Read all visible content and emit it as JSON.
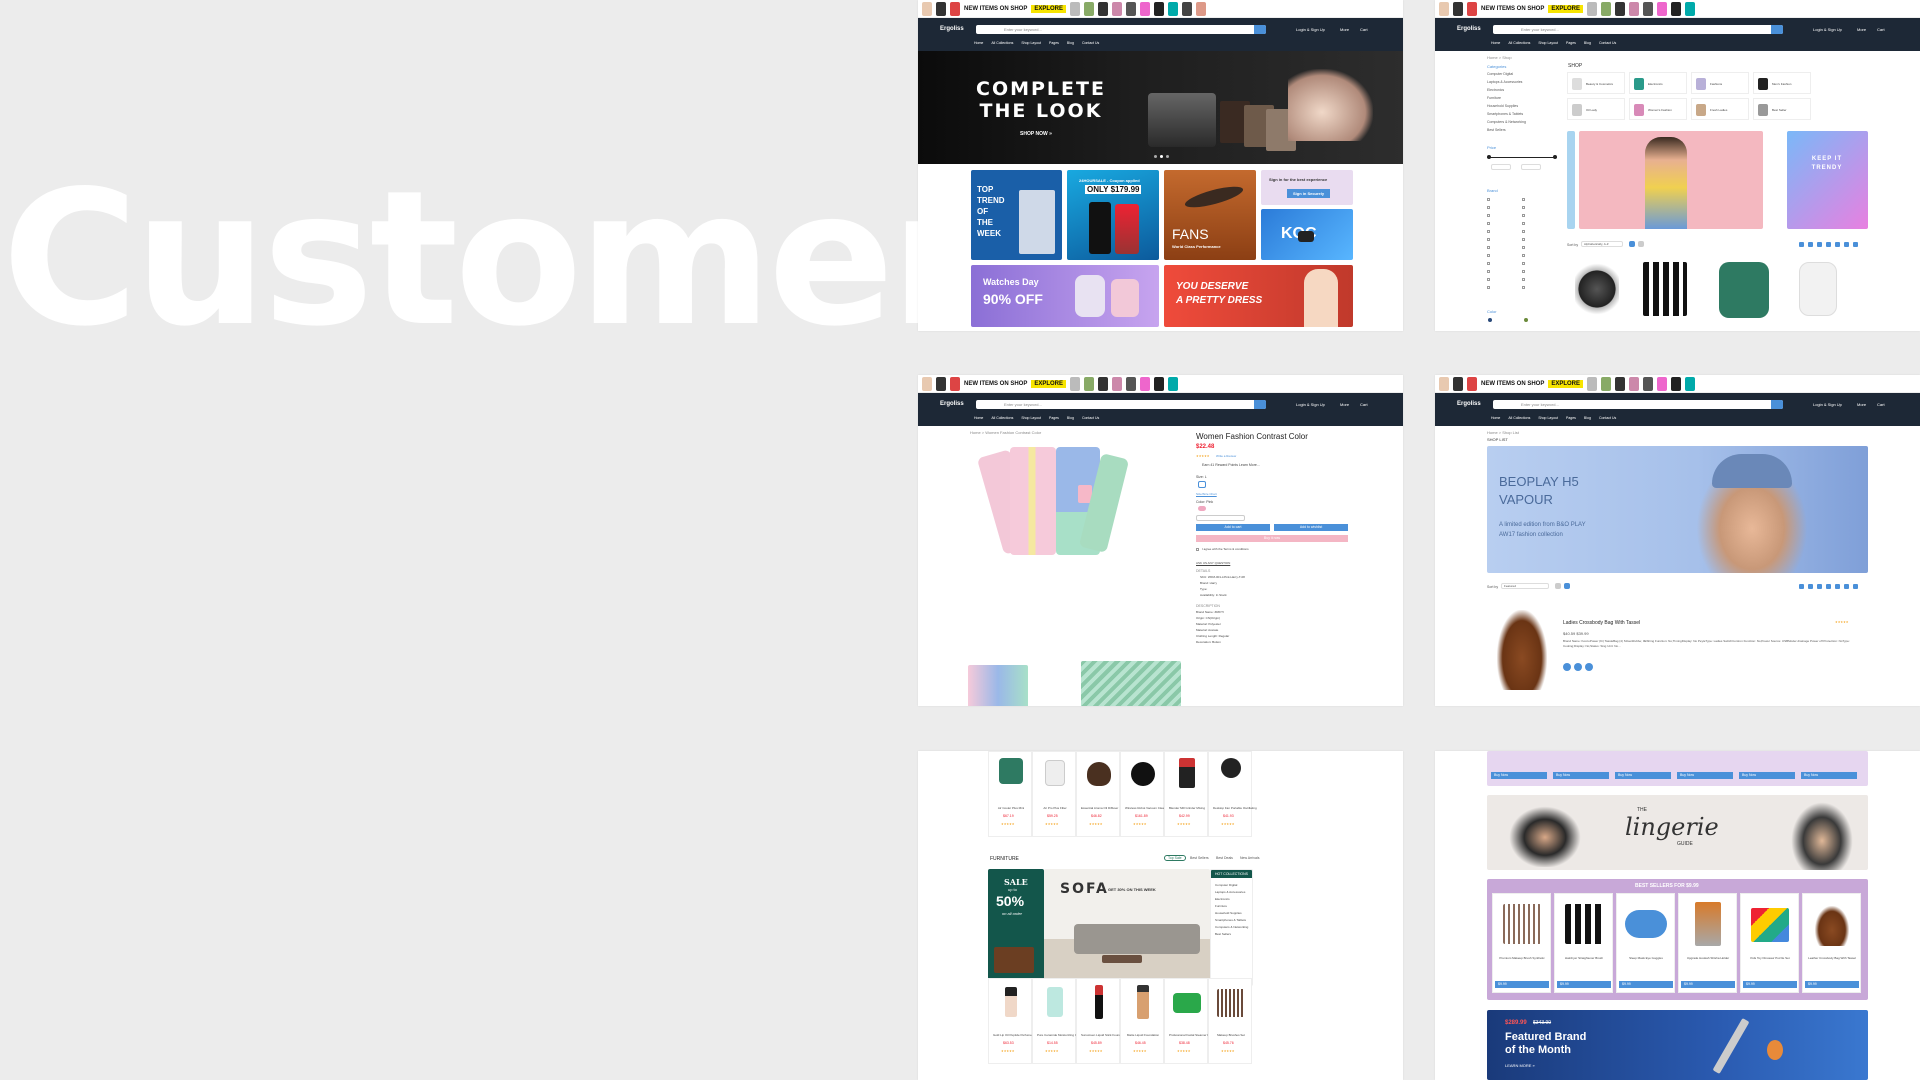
{
  "headline": "Customer",
  "site": {
    "logo": "Ergoliss",
    "promo_text": "NEW ITEMS ON SHOP",
    "promo_button": "EXPLORE",
    "search_cat": "All",
    "search_placeholder": "Enter your keyword...",
    "actions": [
      "Login & Sign Up",
      "More",
      "Cart"
    ],
    "nav": [
      "Home",
      "All Collections",
      "Shop Layout",
      "Pages",
      "Blog",
      "Contact Us"
    ]
  },
  "home": {
    "hero_title_1": "COMPLETE",
    "hero_title_2": "THE LOOK",
    "hero_cta": "SHOP NOW »",
    "tile_trend": [
      "TOP",
      "TREND",
      "OF",
      "THE",
      "WEEK"
    ],
    "tile_phone_tag": "24HOURSALE - Coupon applied",
    "tile_phone_price": "ONLY $179.99",
    "tile_fans": "FANS",
    "tile_fans_sub": "World Class Performance",
    "tile_signin_title": "Sign in for the best experience",
    "tile_signin_btn": "Sign in Securely",
    "tile_video": "KOC",
    "tile_watch_title": "Watches Day",
    "tile_watch_off": "90% OFF",
    "tile_dress": "YOU DESERVE",
    "tile_dress_2": "A PRETTY DRESS"
  },
  "shop": {
    "breadcrumb": "Home  >  Shop",
    "title": "SHOP",
    "categories_title": "Categories",
    "categories": [
      "Computer Digital",
      "Laptops & Accessories",
      "Electronics",
      "Furniture",
      "Household Supplies",
      "Smartphones & Tablets",
      "Computers & Networking",
      "Best Sellers"
    ],
    "price_title": "Price",
    "brand_title": "Brand",
    "color_title": "Color",
    "sort_label": "Sort by",
    "sort_value": "Alphabetically, A-Z",
    "cat_icons": [
      "Beauty & Cosmetics",
      "Electronics",
      "Fashions",
      "Men's Fashion",
      "Oil Lady",
      "Women's Fashion",
      "Fresh Ladies",
      "Best Seller"
    ],
    "banner_title": "KEEP IT TRENDY"
  },
  "product": {
    "breadcrumb": "Home  >  Women Fashion Contrast Color",
    "name": "Women Fashion Contrast Color",
    "price": "$22.48",
    "review_link": "Write a Review",
    "reward": "Earn 41 Reward Points  Learn More...",
    "size_label": "Size: L",
    "size_chart": "Size/Size Chart",
    "color_label": "Color: Pink",
    "add_to_cart": "Add to cart",
    "add_to_wishlist": "Add to wishlist",
    "buy_now": "Buy it now",
    "terms": "I agree with the Terms & conditions",
    "ask": "ASK US ANY QUESTION",
    "details_title": "DETAILS",
    "details": [
      "SKU: WFM-001-LPink-Harry-T-08",
      "Brand: Harry",
      "Type:",
      "Availability: In Stock"
    ],
    "desc_title": "DESCRIPTION",
    "desc": [
      "Brand Name: ZRIFTI",
      "Origin: CN(Origin)",
      "Material: Polyester",
      "Material: Acetate",
      "Clothing Length: Regular",
      "Decoration: Button"
    ]
  },
  "shoplist": {
    "breadcrumb": "Home  >  Shop List",
    "title": "SHOP LIST",
    "banner_title_1": "BEOPLAY H5",
    "banner_title_2": "VAPOUR",
    "banner_sub_1": "A limited edition from B&O PLAY",
    "banner_sub_2": "AW17 fashion collection",
    "sort_label": "Sort by",
    "sort_value": "Featured",
    "item_name": "Ladies Crossbody Bag With Tassel",
    "item_price": "$40.59 $39.99",
    "item_desc": "Brand Name: KoccoPower (Ki) TassleBag (4) StGenRubbe; 0EShing Function: No;TimingDisplay: No PeyleType: Ladies SwitchContron Function: No;Power Source: USBModer drainage Power off Protection: NoType: Cooling;Display: No;Status: Sing Unit: No..."
  },
  "furniture": {
    "section_title": "FURNITURE",
    "tabs": [
      "Top Sale",
      "Best Sellers",
      "Best Deals",
      "New Arrivals"
    ],
    "sale_1": "SALE",
    "sale_2": "up to",
    "sale_pct": "50%",
    "sale_3": "on all order",
    "sofa_title": "SOFA",
    "sofa_sub": "GET 30% ON THIS WEEK",
    "hot_title": "HOT COLLECTIONS",
    "hot_items": [
      "Computer Digital",
      "Laptops & Accessories",
      "Electronics",
      "Furniture",
      "Household Supplies",
      "Smartphones & Tablets",
      "Computers & Networking",
      "Best Sellers"
    ],
    "top_products": [
      {
        "name": "Air Cooler Plus Mini",
        "price": "$67.19"
      },
      {
        "name": "Air Pro Plus Filter",
        "price": "$59.25"
      },
      {
        "name": "Essential Aroma Oil Diffuser",
        "price": "$46.82"
      },
      {
        "name": "Wireless Robot Vacuum Cleaner",
        "price": "$161.89"
      },
      {
        "name": "Blender Mill Grinder Mixing",
        "price": "$42.99"
      },
      {
        "name": "Desktop Fan Portable Oscillating",
        "price": "$41.93"
      }
    ],
    "bottom_products": [
      {
        "name": "Gold Lip Oil Peptide Perfume",
        "price": "$63.53"
      },
      {
        "name": "Pure Ceramide Moisturizing Cream",
        "price": "$14.55"
      },
      {
        "name": "Sunscreen Liquid Stick Foundation",
        "price": "$45.89"
      },
      {
        "name": "Matte Liquid Foundation",
        "price": "$46.45"
      },
      {
        "name": "Professional Facial Steamer Pad",
        "price": "$38.48"
      },
      {
        "name": "Makeup Brushes Set",
        "price": "$45.76"
      }
    ]
  },
  "deals": {
    "buy_now": "Buy Now",
    "lingerie_1": "THE",
    "lingerie_2": "lingerie",
    "lingerie_3": "GUIDE",
    "bestsellers_title": "BEST SELLERS FOR $9.99",
    "items": [
      {
        "name": "Premium Makeup Brush Synthetic",
        "price": "$9.99"
      },
      {
        "name": "Hairdryer Straightener Brush",
        "price": "$9.99"
      },
      {
        "name": "Sleep Mask Eye Goggles",
        "price": "$9.99"
      },
      {
        "name": "Upgrade Hookah Shisha Holder",
        "price": "$9.99"
      },
      {
        "name": "Kids Toy Dinosaur Puzzle Set",
        "price": "$9.99"
      },
      {
        "name": "Leather Crossbody Bag With Tassel",
        "price": "$9.99"
      }
    ],
    "featured_price": "$289.99",
    "featured_old": "$343.99",
    "featured_1": "Featured Brand",
    "featured_2": "of the Month",
    "featured_cta": "LEARN MORE »"
  },
  "colors": {
    "header": "#1d2836",
    "accent": "#4a90d9",
    "promo": "#f7e400",
    "sale": "#e23636"
  }
}
